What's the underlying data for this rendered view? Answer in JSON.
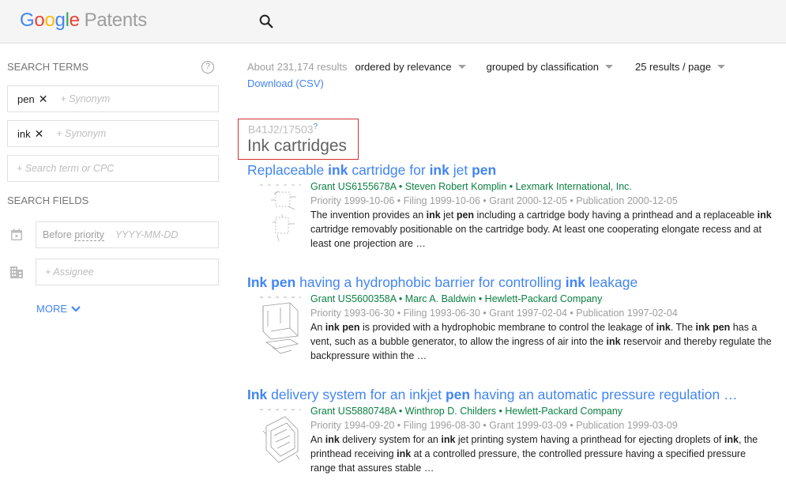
{
  "header": {
    "logo_google": [
      "G",
      "o",
      "o",
      "g",
      "l",
      "e"
    ],
    "logo_product": "Patents"
  },
  "sidebar": {
    "search_terms_title": "SEARCH TERMS",
    "help_glyph": "?",
    "terms": [
      {
        "term": "pen",
        "remove": "✕",
        "synonym_placeholder": "+ Synonym"
      },
      {
        "term": "ink",
        "remove": "✕",
        "synonym_placeholder": "+ Synonym"
      }
    ],
    "new_term_placeholder": "+ Search term or CPC",
    "search_fields_title": "SEARCH FIELDS",
    "before_label": "Before ",
    "before_link": "priority",
    "date_placeholder": "YYYY-MM-DD",
    "assignee_placeholder": "+ Assignee",
    "more_label": "MORE"
  },
  "toolbar": {
    "count": "About 231,174 results",
    "order": "ordered by relevance",
    "group": "grouped by classification",
    "per_page": "25 results / page",
    "download": "Download (CSV)"
  },
  "group": {
    "cpc_code": "B41J2/17503",
    "help": "?",
    "name": "Ink cartridges"
  },
  "results": [
    {
      "title_parts": [
        [
          "Replaceable ",
          0
        ],
        [
          "ink",
          1
        ],
        [
          " cartridge for ",
          0
        ],
        [
          "ink",
          1
        ],
        [
          " jet ",
          0
        ],
        [
          "pen",
          1
        ]
      ],
      "meta": "Grant US6155678A • Steven Robert Komplin • Lexmark International, Inc.",
      "dates": "Priority 1999-10-06 • Filing 1999-10-06 • Grant 2000-12-05 • Publication 2000-12-05",
      "snippet_parts": [
        [
          "The invention provides an ",
          0
        ],
        [
          "ink",
          1
        ],
        [
          " jet ",
          0
        ],
        [
          "pen",
          1
        ],
        [
          " including a cartridge body having a printhead and a replaceable ",
          0
        ],
        [
          "ink",
          1
        ],
        [
          " cartridge removably positionable on the cartridge body. At least one cooperating elongate recess and at least one projection are …",
          0
        ]
      ]
    },
    {
      "title_parts": [
        [
          "Ink pen",
          1
        ],
        [
          " having a hydrophobic barrier for controlling ",
          0
        ],
        [
          "ink",
          1
        ],
        [
          " leakage",
          0
        ]
      ],
      "meta": "Grant US5600358A • Marc A. Baldwin • Hewlett-Packard Company",
      "dates": "Priority 1993-06-30 • Filing 1993-06-30 • Grant 1997-02-04 • Publication 1997-02-04",
      "snippet_parts": [
        [
          "An ",
          0
        ],
        [
          "ink pen",
          1
        ],
        [
          " is provided with a hydrophobic membrane to control the leakage of ",
          0
        ],
        [
          "ink",
          1
        ],
        [
          ". The ",
          0
        ],
        [
          "ink pen",
          1
        ],
        [
          " has a vent, such as a bubble generator, to allow the ingress of air into the ",
          0
        ],
        [
          "ink",
          1
        ],
        [
          " reservoir and thereby regulate the backpressure within the …",
          0
        ]
      ]
    },
    {
      "title_parts": [
        [
          "Ink",
          1
        ],
        [
          " delivery system for an inkjet ",
          0
        ],
        [
          "pen",
          1
        ],
        [
          " having an automatic pressure regulation …",
          0
        ]
      ],
      "meta": "Grant US5880748A • Winthrop D. Childers • Hewlett-Packard Company",
      "dates": "Priority 1994-09-20 • Filing 1996-08-30 • Grant 1999-03-09 • Publication 1999-03-09",
      "snippet_parts": [
        [
          "An ",
          0
        ],
        [
          "ink",
          1
        ],
        [
          " delivery system for an ",
          0
        ],
        [
          "ink",
          1
        ],
        [
          " jet printing system having a printhead for ejecting droplets of ",
          0
        ],
        [
          "ink",
          1
        ],
        [
          ", the printhead receiving ",
          0
        ],
        [
          "ink",
          1
        ],
        [
          " at a controlled pressure, the controlled pressure having a specified pressure range that assures stable …",
          0
        ]
      ]
    }
  ]
}
